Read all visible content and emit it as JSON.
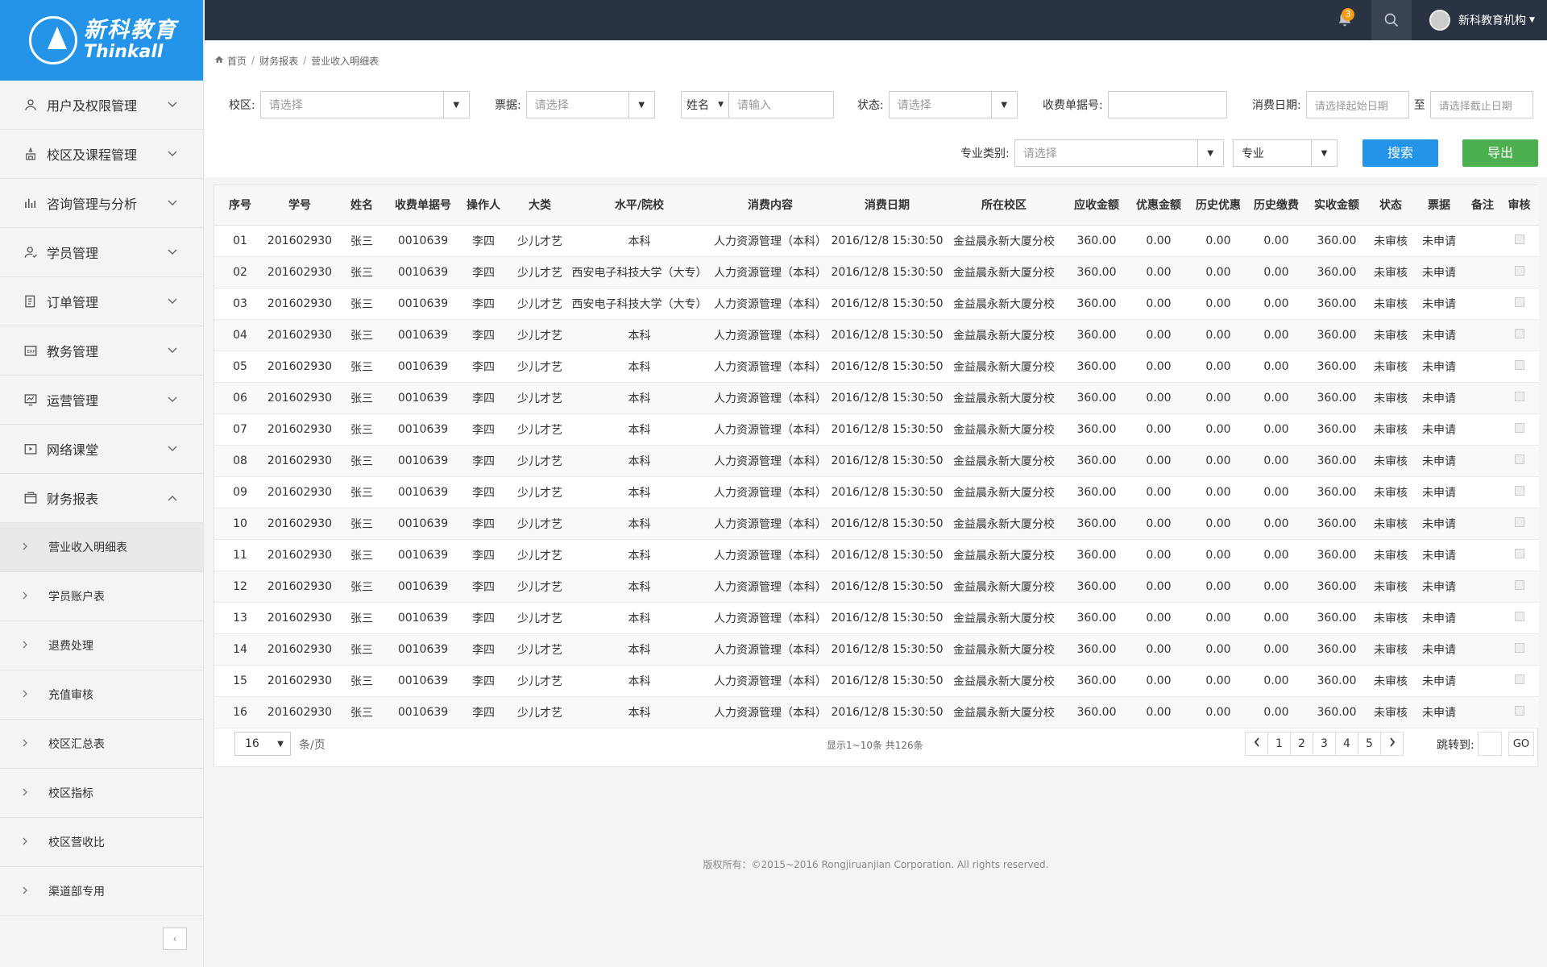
{
  "brand": {
    "cn": "新科教育",
    "en": "Thinkall"
  },
  "topbar": {
    "notification_count": "3",
    "user_name": "新科教育机构"
  },
  "breadcrumb": [
    "首页",
    "财务报表",
    "营业收入明细表"
  ],
  "sidebar": {
    "items": [
      {
        "label": "用户及权限管理",
        "icon": "user-icon"
      },
      {
        "label": "校区及课程管理",
        "icon": "campus-icon"
      },
      {
        "label": "咨询管理与分析",
        "icon": "chart-icon"
      },
      {
        "label": "学员管理",
        "icon": "student-icon"
      },
      {
        "label": "订单管理",
        "icon": "order-icon"
      },
      {
        "label": "教务管理",
        "icon": "erp-icon"
      },
      {
        "label": "运营管理",
        "icon": "monitor-icon"
      },
      {
        "label": "网络课堂",
        "icon": "video-icon"
      },
      {
        "label": "财务报表",
        "icon": "finance-icon"
      }
    ],
    "sub_items": [
      "营业收入明细表",
      "学员账户表",
      "退费处理",
      "充值审核",
      "校区汇总表",
      "校区指标",
      "校区营收比",
      "渠道部专用"
    ]
  },
  "filters": {
    "campus_label": "校区:",
    "campus_placeholder": "请选择",
    "ticket_label": "票据:",
    "ticket_placeholder": "请选择",
    "name_select": "姓名",
    "name_placeholder": "请输入",
    "status_label": "状态:",
    "status_placeholder": "请选择",
    "receipt_label": "收费单据号:",
    "receipt_value": "",
    "date_label": "消费日期:",
    "date_start_placeholder": "请选择起始日期",
    "date_to": "至",
    "date_end_placeholder": "请选择截止日期",
    "major_type_label": "专业类别:",
    "major_type_placeholder": "请选择",
    "major_select": "专业",
    "search_btn": "搜索",
    "export_btn": "导出"
  },
  "table": {
    "headers": [
      "序号",
      "学号",
      "姓名",
      "收费单据号",
      "操作人",
      "大类",
      "水平/院校",
      "消费内容",
      "消费日期",
      "所在校区",
      "应收金额",
      "优惠金额",
      "历史优惠",
      "历史缴费",
      "实收金额",
      "状态",
      "票据",
      "备注",
      "审核"
    ],
    "rows": [
      [
        "01",
        "201602930",
        "张三",
        "0010639",
        "李四",
        "少儿才艺",
        "本科",
        "人力资源管理（本科）",
        "2016/12/8 15:30:50",
        "金益晨永新大厦分校",
        "360.00",
        "0.00",
        "0.00",
        "0.00",
        "360.00",
        "未审核",
        "未申请",
        ""
      ],
      [
        "02",
        "201602930",
        "张三",
        "0010639",
        "李四",
        "少儿才艺",
        "西安电子科技大学（大专）",
        "人力资源管理（本科）",
        "2016/12/8 15:30:50",
        "金益晨永新大厦分校",
        "360.00",
        "0.00",
        "0.00",
        "0.00",
        "360.00",
        "未审核",
        "未申请",
        ""
      ],
      [
        "03",
        "201602930",
        "张三",
        "0010639",
        "李四",
        "少儿才艺",
        "西安电子科技大学（大专）",
        "人力资源管理（本科）",
        "2016/12/8 15:30:50",
        "金益晨永新大厦分校",
        "360.00",
        "0.00",
        "0.00",
        "0.00",
        "360.00",
        "未审核",
        "未申请",
        ""
      ],
      [
        "04",
        "201602930",
        "张三",
        "0010639",
        "李四",
        "少儿才艺",
        "本科",
        "人力资源管理（本科）",
        "2016/12/8 15:30:50",
        "金益晨永新大厦分校",
        "360.00",
        "0.00",
        "0.00",
        "0.00",
        "360.00",
        "未审核",
        "未申请",
        ""
      ],
      [
        "05",
        "201602930",
        "张三",
        "0010639",
        "李四",
        "少儿才艺",
        "本科",
        "人力资源管理（本科）",
        "2016/12/8 15:30:50",
        "金益晨永新大厦分校",
        "360.00",
        "0.00",
        "0.00",
        "0.00",
        "360.00",
        "未审核",
        "未申请",
        ""
      ],
      [
        "06",
        "201602930",
        "张三",
        "0010639",
        "李四",
        "少儿才艺",
        "本科",
        "人力资源管理（本科）",
        "2016/12/8 15:30:50",
        "金益晨永新大厦分校",
        "360.00",
        "0.00",
        "0.00",
        "0.00",
        "360.00",
        "未审核",
        "未申请",
        ""
      ],
      [
        "07",
        "201602930",
        "张三",
        "0010639",
        "李四",
        "少儿才艺",
        "本科",
        "人力资源管理（本科）",
        "2016/12/8 15:30:50",
        "金益晨永新大厦分校",
        "360.00",
        "0.00",
        "0.00",
        "0.00",
        "360.00",
        "未审核",
        "未申请",
        ""
      ],
      [
        "08",
        "201602930",
        "张三",
        "0010639",
        "李四",
        "少儿才艺",
        "本科",
        "人力资源管理（本科）",
        "2016/12/8 15:30:50",
        "金益晨永新大厦分校",
        "360.00",
        "0.00",
        "0.00",
        "0.00",
        "360.00",
        "未审核",
        "未申请",
        ""
      ],
      [
        "09",
        "201602930",
        "张三",
        "0010639",
        "李四",
        "少儿才艺",
        "本科",
        "人力资源管理（本科）",
        "2016/12/8 15:30:50",
        "金益晨永新大厦分校",
        "360.00",
        "0.00",
        "0.00",
        "0.00",
        "360.00",
        "未审核",
        "未申请",
        ""
      ],
      [
        "10",
        "201602930",
        "张三",
        "0010639",
        "李四",
        "少儿才艺",
        "本科",
        "人力资源管理（本科）",
        "2016/12/8 15:30:50",
        "金益晨永新大厦分校",
        "360.00",
        "0.00",
        "0.00",
        "0.00",
        "360.00",
        "未审核",
        "未申请",
        ""
      ],
      [
        "11",
        "201602930",
        "张三",
        "0010639",
        "李四",
        "少儿才艺",
        "本科",
        "人力资源管理（本科）",
        "2016/12/8 15:30:50",
        "金益晨永新大厦分校",
        "360.00",
        "0.00",
        "0.00",
        "0.00",
        "360.00",
        "未审核",
        "未申请",
        ""
      ],
      [
        "12",
        "201602930",
        "张三",
        "0010639",
        "李四",
        "少儿才艺",
        "本科",
        "人力资源管理（本科）",
        "2016/12/8 15:30:50",
        "金益晨永新大厦分校",
        "360.00",
        "0.00",
        "0.00",
        "0.00",
        "360.00",
        "未审核",
        "未申请",
        ""
      ],
      [
        "13",
        "201602930",
        "张三",
        "0010639",
        "李四",
        "少儿才艺",
        "本科",
        "人力资源管理（本科）",
        "2016/12/8 15:30:50",
        "金益晨永新大厦分校",
        "360.00",
        "0.00",
        "0.00",
        "0.00",
        "360.00",
        "未审核",
        "未申请",
        ""
      ],
      [
        "14",
        "201602930",
        "张三",
        "0010639",
        "李四",
        "少儿才艺",
        "本科",
        "人力资源管理（本科）",
        "2016/12/8 15:30:50",
        "金益晨永新大厦分校",
        "360.00",
        "0.00",
        "0.00",
        "0.00",
        "360.00",
        "未审核",
        "未申请",
        ""
      ],
      [
        "15",
        "201602930",
        "张三",
        "0010639",
        "李四",
        "少儿才艺",
        "本科",
        "人力资源管理（本科）",
        "2016/12/8 15:30:50",
        "金益晨永新大厦分校",
        "360.00",
        "0.00",
        "0.00",
        "0.00",
        "360.00",
        "未审核",
        "未申请",
        ""
      ],
      [
        "16",
        "201602930",
        "张三",
        "0010639",
        "李四",
        "少儿才艺",
        "本科",
        "人力资源管理（本科）",
        "2016/12/8 15:30:50",
        "金益晨永新大厦分校",
        "360.00",
        "0.00",
        "0.00",
        "0.00",
        "360.00",
        "未审核",
        "未申请",
        ""
      ]
    ]
  },
  "pagination": {
    "page_size": "16",
    "per_page_label": "条/页",
    "info": "显示1~10条  共126条",
    "pages": [
      "1",
      "2",
      "3",
      "4",
      "5"
    ],
    "jump_label": "跳转到:",
    "go_label": "GO"
  },
  "footer": "版权所有：©2015~2016 Rongjiruanjian Corporation. All rights reserved.",
  "colors": {
    "brand_blue": "#2494e8",
    "topbar": "#2a3342",
    "search_btn": "#2494e8",
    "export_btn": "#4caf50",
    "badge": "#f39c12"
  }
}
